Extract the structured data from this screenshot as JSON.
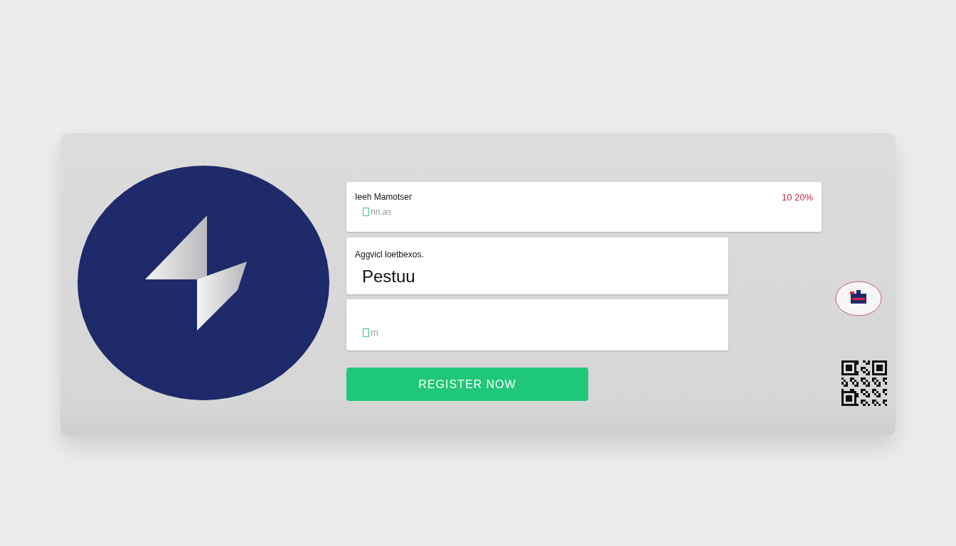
{
  "fields": [
    {
      "kind": "stat",
      "label": "Ieeh Mamotser",
      "placeholder": "nn.as",
      "badge": "10 20%"
    },
    {
      "kind": "input",
      "label": "Aggvicl loetbexos.",
      "value": "Pestuu"
    },
    {
      "kind": "hint",
      "placeholder": "rn"
    }
  ],
  "button": {
    "label": "REGISTER NOW"
  }
}
